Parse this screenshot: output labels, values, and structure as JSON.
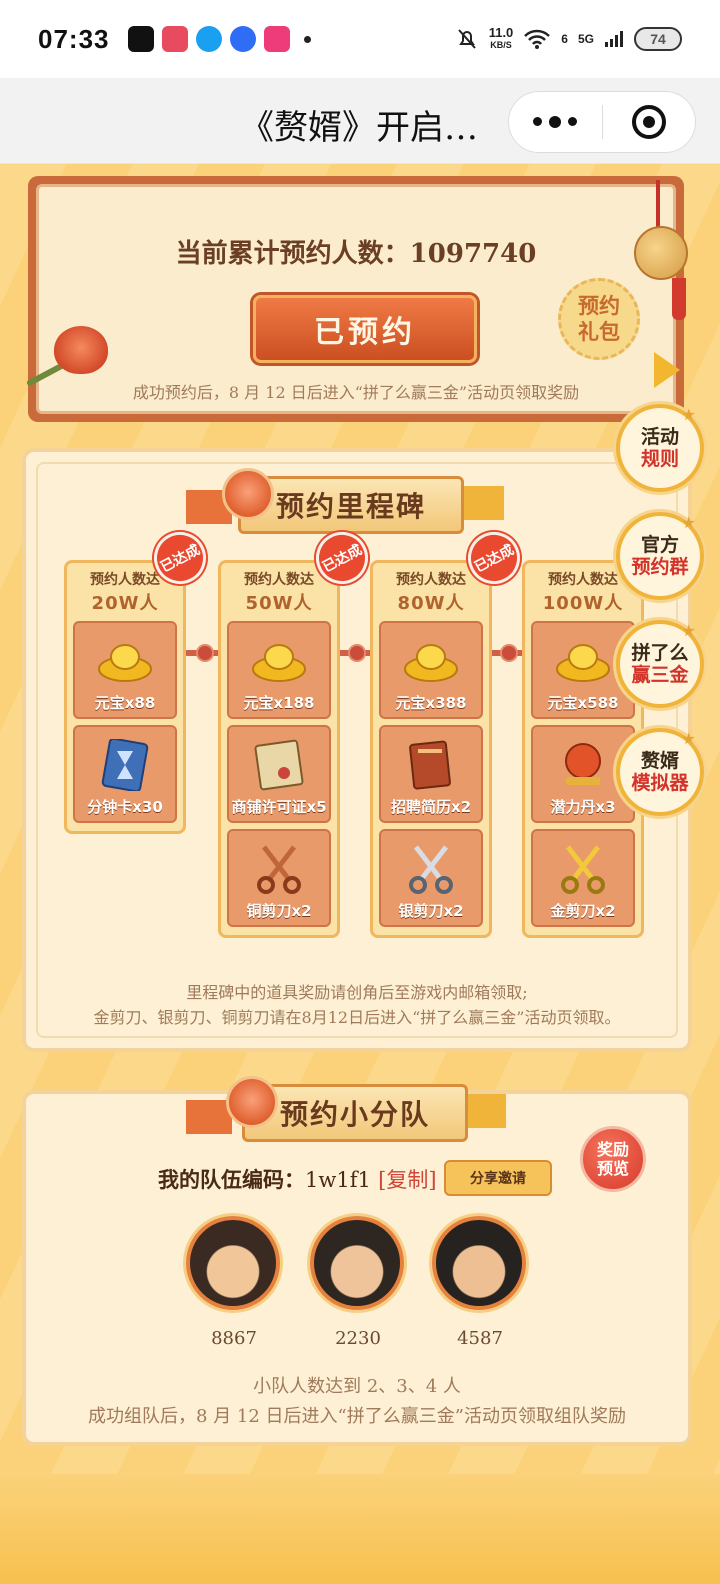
{
  "status_bar": {
    "time": "07:33",
    "speed_value": "11.0",
    "speed_unit": "KB/S",
    "network": "5G",
    "sim": "6",
    "battery": "74",
    "app_icons": [
      "tiktok-icon",
      "clown-app-icon",
      "qq-icon",
      "chat-app-icon",
      "music-app-icon"
    ]
  },
  "title_bar": {
    "title": "《赘婿》开启…"
  },
  "reservation": {
    "count_label": "当前累计预约人数：1097740",
    "button_label": "已预约",
    "note": "成功预约后，8 月 12 日后进入“拼了么赢三金”活动页领取奖励",
    "gift_badge": [
      "预约",
      "礼包"
    ]
  },
  "side_buttons": [
    {
      "line1": "活动",
      "line2": "规则"
    },
    {
      "line1": "官方",
      "line2": "预约群"
    },
    {
      "line1": "拼了么",
      "line2": "赢三金"
    },
    {
      "line1": "赘婿",
      "line2": "模拟器"
    }
  ],
  "milestones": {
    "title": "预约里程碑",
    "done_label": "已达成",
    "columns": [
      {
        "cond": "预约人数达",
        "num": "20W人",
        "done": true,
        "items": [
          "元宝x88",
          "分钟卡x30"
        ]
      },
      {
        "cond": "预约人数达",
        "num": "50W人",
        "done": true,
        "items": [
          "元宝x188",
          "商铺许可证x5",
          "铜剪刀x2"
        ]
      },
      {
        "cond": "预约人数达",
        "num": "80W人",
        "done": true,
        "items": [
          "元宝x388",
          "招聘简历x2",
          "银剪刀x2"
        ]
      },
      {
        "cond": "预约人数达",
        "num": "100W人",
        "done": false,
        "items": [
          "元宝x588",
          "潜力丹x3",
          "金剪刀x2"
        ]
      }
    ],
    "note_line1": "里程碑中的道具奖励请创角后至游戏内邮箱领取;",
    "note_line2": "金剪刀、银剪刀、铜剪刀请在8月12日后进入“拼了么赢三金”活动页领取。"
  },
  "team": {
    "title": "预约小分队",
    "code_label": "我的队伍编码：",
    "code": "1w1f1",
    "copy_label": "[复制]",
    "share_button": "分享邀请",
    "reward_preview": [
      "奖励",
      "预览"
    ],
    "members": [
      {
        "score": "8867"
      },
      {
        "score": "2230"
      },
      {
        "score": "4587"
      }
    ],
    "note_line1": "小队人数达到 2、3、4 人",
    "note_line2": "成功组队后，8 月 12 日后进入“拼了么赢三金”活动页领取组队奖励"
  },
  "colors": {
    "accent_orange": "#cc4f22",
    "gold": "#f0b43a",
    "panel_bg": "#fdf0d4",
    "badge_red": "#e8492f"
  }
}
